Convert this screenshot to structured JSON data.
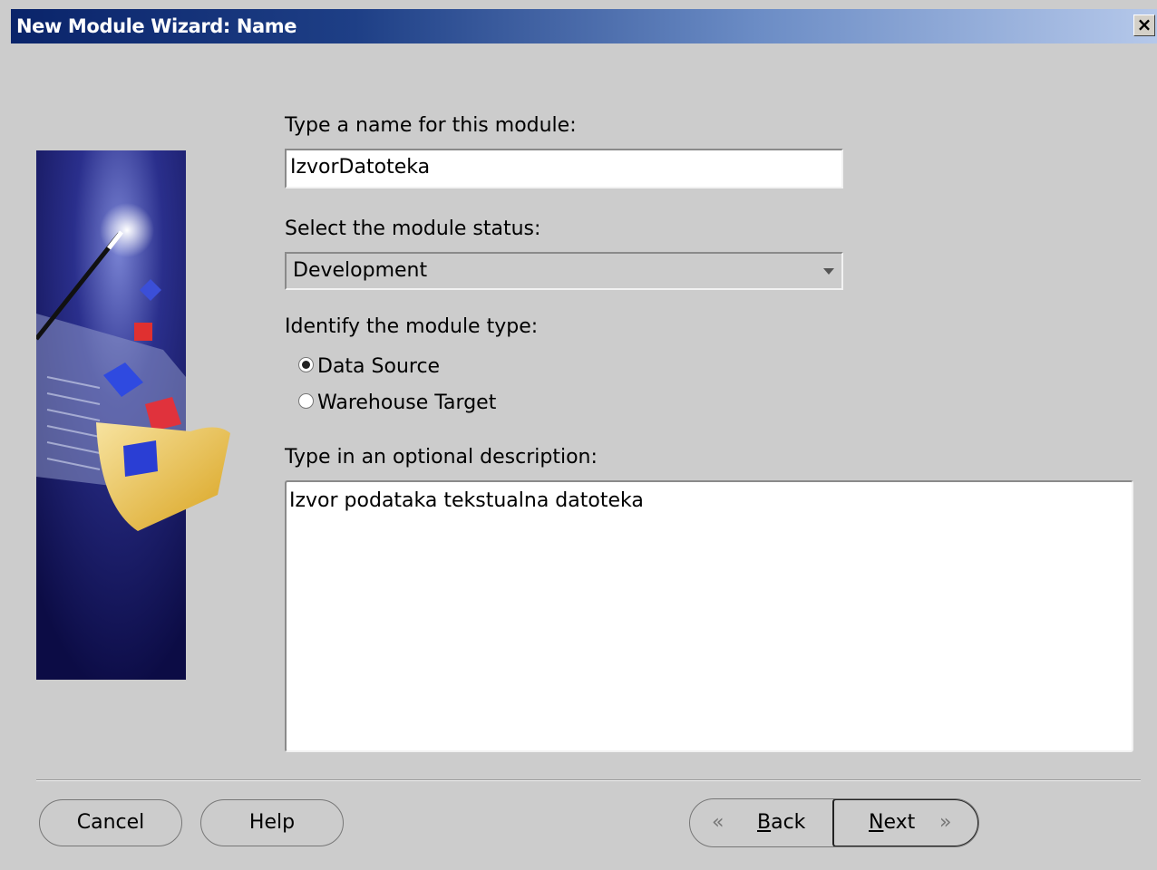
{
  "window": {
    "title": "New Module Wizard: Name",
    "close_label": "×"
  },
  "form": {
    "name_label": "Type a name for this module:",
    "name_value": "IzvorDatoteka",
    "status_label": "Select the module status:",
    "status_value": "Development",
    "type_label": "Identify the module type:",
    "type_options": [
      {
        "label": "Data Source",
        "selected": true
      },
      {
        "label": "Warehouse Target",
        "selected": false
      }
    ],
    "description_label": "Type in an optional description:",
    "description_value": "Izvor podataka tekstualna datoteka"
  },
  "buttons": {
    "cancel": "Cancel",
    "help": "Help",
    "back_mnemonic": "B",
    "back_rest": "ack",
    "next_mnemonic": "N",
    "next_rest": "ext",
    "back_icon": "«",
    "next_icon": "»"
  },
  "colors": {
    "titlebar_start": "#0a246a",
    "titlebar_end": "#b5c8ea",
    "background": "#cccccc"
  }
}
